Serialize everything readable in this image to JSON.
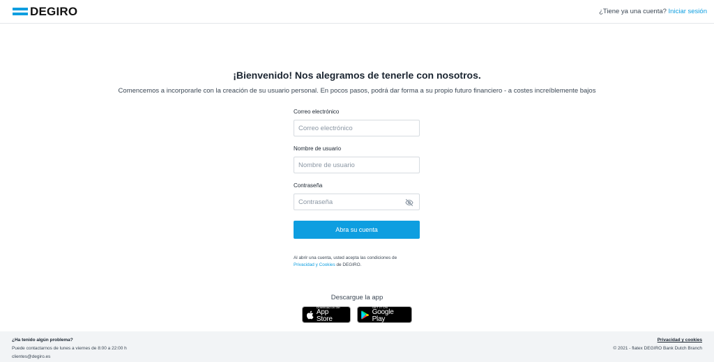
{
  "header": {
    "logo_text": "DEGIRO",
    "account_question": "¿Tiene ya una cuenta?",
    "login_link": "Iniciar sesión"
  },
  "main": {
    "title": "¡Bienvenido! Nos alegramos de tenerle con nosotros.",
    "subtitle": "Comencemos a incorporarle con la creación de su usuario personal. En pocos pasos, podrá dar forma a su propio futuro financiero - a costes increíblemente bajos"
  },
  "form": {
    "email": {
      "label": "Correo electrónico",
      "placeholder": "Correo electrónico",
      "value": ""
    },
    "username": {
      "label": "Nombre de usuario",
      "placeholder": "Nombre de usuario",
      "value": ""
    },
    "password": {
      "label": "Contraseña",
      "placeholder": "Contraseña",
      "value": ""
    },
    "submit_label": "Abra su cuenta",
    "terms_text": "Al abrir una cuenta, usted acepta las condiciones de",
    "terms_link": "Privacidad y Cookies",
    "terms_suffix": "de DEGIRO."
  },
  "app": {
    "title": "Descargue la app",
    "apple_small": "Download on the",
    "apple_big": "App Store",
    "google_small": "GET IT ON",
    "google_big": "Google Play"
  },
  "footer": {
    "problem_title": "¿Ha tenido algún problema?",
    "contact_hours": "Puede contactarnos de lunes a viernes de 8:00 a 22:00 h",
    "email": "clientes@degiro.es",
    "privacy_link": "Privacidad y cookies",
    "copyright": "© 2021 - flatex DEGIRO Bank Dutch Branch"
  },
  "colors": {
    "accent": "#0e9ee0",
    "footer_bg": "#f2f4f6"
  },
  "icons": {
    "logo": "degiro-logo-icon",
    "password_toggle": "eye-slash-icon",
    "apple": "apple-icon",
    "google_play": "google-play-icon"
  }
}
